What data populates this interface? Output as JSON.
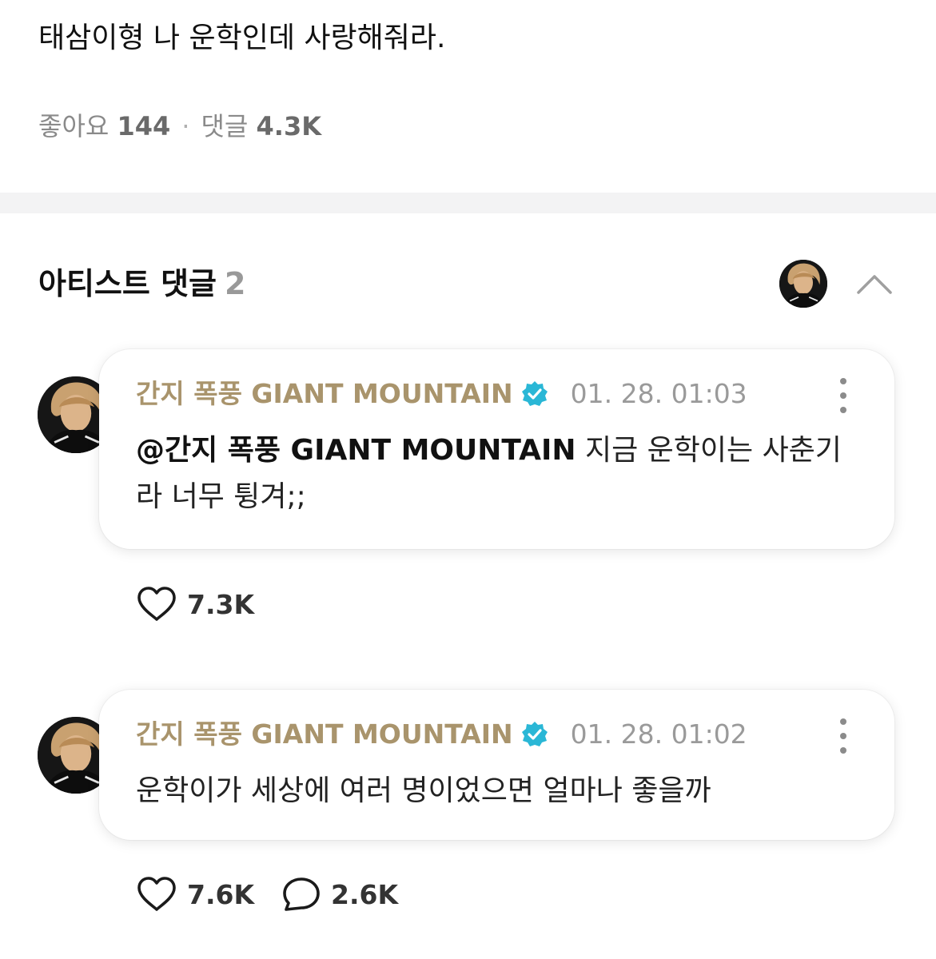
{
  "post": {
    "text": "태삼이형 나 운학인데 사랑해줘라.",
    "likes_label": "좋아요",
    "likes_count": "144",
    "separator": "·",
    "comments_label": "댓글",
    "comments_count": "4.3K"
  },
  "artist_comments": {
    "title": "아티스트 댓글",
    "count": "2",
    "comments": [
      {
        "author": "간지 폭풍 GIANT MOUNTAIN",
        "timestamp": "01. 28. 01:03",
        "mention": "@간지 폭풍 GIANT MOUNTAIN",
        "text": " 지금 운학이는 사춘기라 너무 튕겨;;",
        "likes": "7.3K"
      },
      {
        "author": "간지 폭풍 GIANT MOUNTAIN",
        "timestamp": "01. 28. 01:02",
        "text": "운학이가 세상에 여러 명이었으면 얼마나 좋을까",
        "likes": "7.6K",
        "replies": "2.6K"
      }
    ]
  },
  "icons": {
    "like": "heart-icon",
    "reply": "speech-bubble-icon",
    "verified": "verified-badge-icon",
    "more": "more-vertical-icon",
    "collapse": "chevron-up-icon"
  },
  "colors": {
    "author": "#a9946c",
    "verified": "#2ab7d6",
    "divider": "#f3f3f4",
    "muted": "#9a9a9a"
  }
}
